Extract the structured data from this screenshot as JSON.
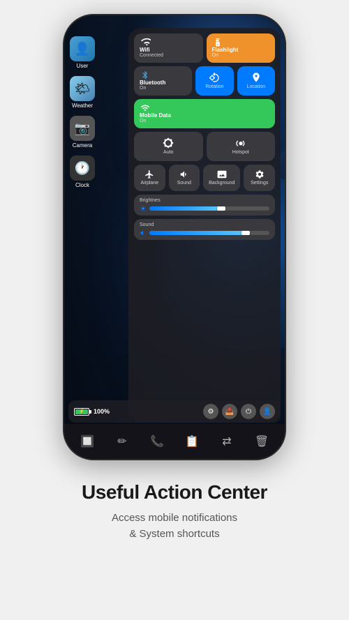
{
  "phone": {
    "wallpaper": "space-earth"
  },
  "apps": [
    {
      "id": "user",
      "label": "User",
      "icon": "👤",
      "class": "icon-user"
    },
    {
      "id": "weather",
      "label": "Weather",
      "icon": "🌤",
      "class": "icon-weather"
    },
    {
      "id": "camera",
      "label": "Camera",
      "icon": "📷",
      "class": "icon-camera"
    },
    {
      "id": "clock",
      "label": "Clock",
      "icon": "🕐",
      "class": "icon-clock"
    }
  ],
  "control_center": {
    "rows": [
      {
        "tiles": [
          {
            "id": "wifi",
            "label": "Wifi",
            "sub": "Connected",
            "bg": "#3a3a3e",
            "icon": "wifi"
          },
          {
            "id": "flashlight",
            "label": "Flashlight",
            "sub": "On",
            "bg": "#f0922b",
            "icon": "flashlight"
          }
        ]
      },
      {
        "tiles": [
          {
            "id": "bluetooth",
            "label": "Bluetooth",
            "sub": "On",
            "bg": "#3a3a3e",
            "icon": "bluetooth"
          },
          {
            "id": "rotation",
            "label": "Rotation",
            "sub": "",
            "bg": "#007aff",
            "icon": "rotation"
          },
          {
            "id": "location",
            "label": "Location",
            "sub": "",
            "bg": "#007aff",
            "icon": "location"
          }
        ]
      },
      {
        "tiles": [
          {
            "id": "mobile_data",
            "label": "Mobile Data",
            "sub": "On",
            "bg": "#34c759",
            "icon": "signal"
          }
        ]
      },
      {
        "tiles": [
          {
            "id": "auto",
            "label": "Auto",
            "bg": "#3a3a3e",
            "icon": "brightness"
          },
          {
            "id": "hotspot",
            "label": "Hotspot",
            "bg": "#3a3a3e",
            "icon": "hotspot"
          }
        ]
      },
      {
        "tiles": [
          {
            "id": "airplane",
            "label": "Airplane",
            "bg": "#3a3a3e",
            "icon": "airplane"
          },
          {
            "id": "sound",
            "label": "Sound",
            "bg": "#3a3a3e",
            "icon": "sound"
          },
          {
            "id": "background",
            "label": "Background",
            "bg": "#3a3a3e",
            "icon": "background"
          },
          {
            "id": "settings",
            "label": "Settings",
            "bg": "#3a3a3e",
            "icon": "settings"
          }
        ]
      }
    ],
    "sliders": [
      {
        "id": "brightness",
        "label": "Brightnes",
        "value": 60
      },
      {
        "id": "sound",
        "label": "Sound",
        "value": 80
      }
    ]
  },
  "status_bar": {
    "battery_percent": "100%",
    "charging": true
  },
  "dock": {
    "icons": [
      "finder",
      "pen",
      "phone",
      "notes",
      "switch",
      "trash"
    ]
  },
  "footer": {
    "title": "Useful Action Center",
    "subtitle": "Access mobile notifications\n& System shortcuts"
  }
}
